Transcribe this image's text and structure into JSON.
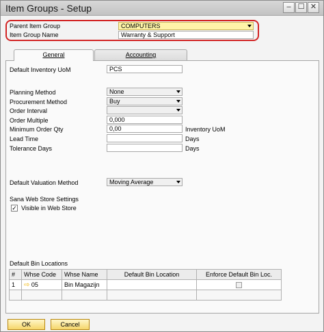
{
  "window": {
    "title": "Item Groups - Setup",
    "minimize_glyph": "–",
    "maximize_glyph": "☐",
    "close_glyph": "✕"
  },
  "header": {
    "parent_group_label": "Parent Item Group",
    "parent_group_value": "COMPUTERS",
    "name_label": "Item Group Name",
    "name_value": "Warranty & Support"
  },
  "tabs": [
    {
      "label": "General",
      "active": true
    },
    {
      "label": "Accounting",
      "active": false
    }
  ],
  "general": {
    "default_uom_label": "Default Inventory UoM",
    "default_uom_value": "PCS",
    "planning_method_label": "Planning Method",
    "planning_method_value": "None",
    "procurement_method_label": "Procurement Method",
    "procurement_method_value": "Buy",
    "order_interval_label": "Order Interval",
    "order_interval_value": "",
    "order_multiple_label": "Order Multiple",
    "order_multiple_value": "0,000",
    "min_order_qty_label": "Minimum Order Qty",
    "min_order_qty_value": "0,00",
    "min_order_qty_unit": "Inventory UoM",
    "lead_time_label": "Lead Time",
    "lead_time_value": "",
    "lead_time_unit": "Days",
    "tolerance_days_label": "Tolerance Days",
    "tolerance_days_value": "",
    "tolerance_days_unit": "Days",
    "valuation_method_label": "Default Valuation Method",
    "valuation_method_value": "Moving Average",
    "web_store_heading": "Sana Web Store Settings",
    "visible_label": "Visible in Web Store",
    "visible_checked": true,
    "bin_locations_heading": "Default Bin Locations"
  },
  "bin_table": {
    "columns": [
      "#",
      "Whse Code",
      "Whse Name",
      "Default Bin Location",
      "Enforce Default Bin Loc."
    ],
    "rows": [
      {
        "num": "1",
        "whse_code": "05",
        "whse_name": "Bin Magazijn",
        "default_bin": "",
        "enforce": false
      }
    ]
  },
  "buttons": {
    "ok": "OK",
    "cancel": "Cancel"
  },
  "colors": {
    "highlight_border": "#d22323",
    "button_fill": "#f5d66a",
    "link_arrow": "#f0b400"
  }
}
